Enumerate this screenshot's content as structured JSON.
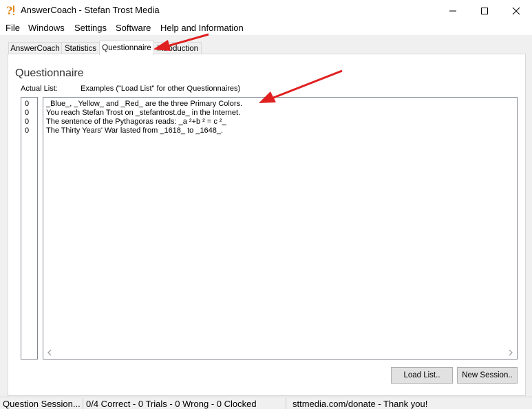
{
  "window": {
    "title": "AnswerCoach - Stefan Trost Media",
    "controls": {
      "minimize_icon": "minimize-icon",
      "maximize_icon": "maximize-icon",
      "close_icon": "close-icon"
    }
  },
  "menu": {
    "items": [
      "File",
      "Windows",
      "Settings",
      "Software",
      "Help and Information"
    ]
  },
  "tabs": [
    {
      "label": "AnswerCoach",
      "active": false
    },
    {
      "label": "Statistics",
      "active": false
    },
    {
      "label": "Questionnaire",
      "active": true
    },
    {
      "label": "Introduction",
      "active": false
    }
  ],
  "panel": {
    "title": "Questionnaire",
    "actual_list_label": "Actual List:",
    "examples_label": "Examples (\"Load List\" for other Questionnaires)"
  },
  "list": {
    "counts": [
      "0",
      "0",
      "0",
      "0"
    ],
    "lines": [
      "_Blue_, _Yellow_ and _Red_ are the three Primary Colors.",
      "You reach Stefan Trost on _stefantrost.de_ in the Internet.",
      "The sentence of the Pythagoras reads: _a ²+b ² = c ²_",
      "The Thirty Years' War lasted from _1618_ to _1648_."
    ]
  },
  "buttons": {
    "load_list": "Load List..",
    "new_session": "New Session.."
  },
  "status": {
    "session": "Question Session...",
    "stats": "0/4 Correct - 0 Trials - 0 Wrong - 0 Clocked",
    "donate": "sttmedia.com/donate - Thank you!"
  },
  "colors": {
    "annotation_arrow": "#e02020",
    "app_icon": "#e08a1e"
  }
}
